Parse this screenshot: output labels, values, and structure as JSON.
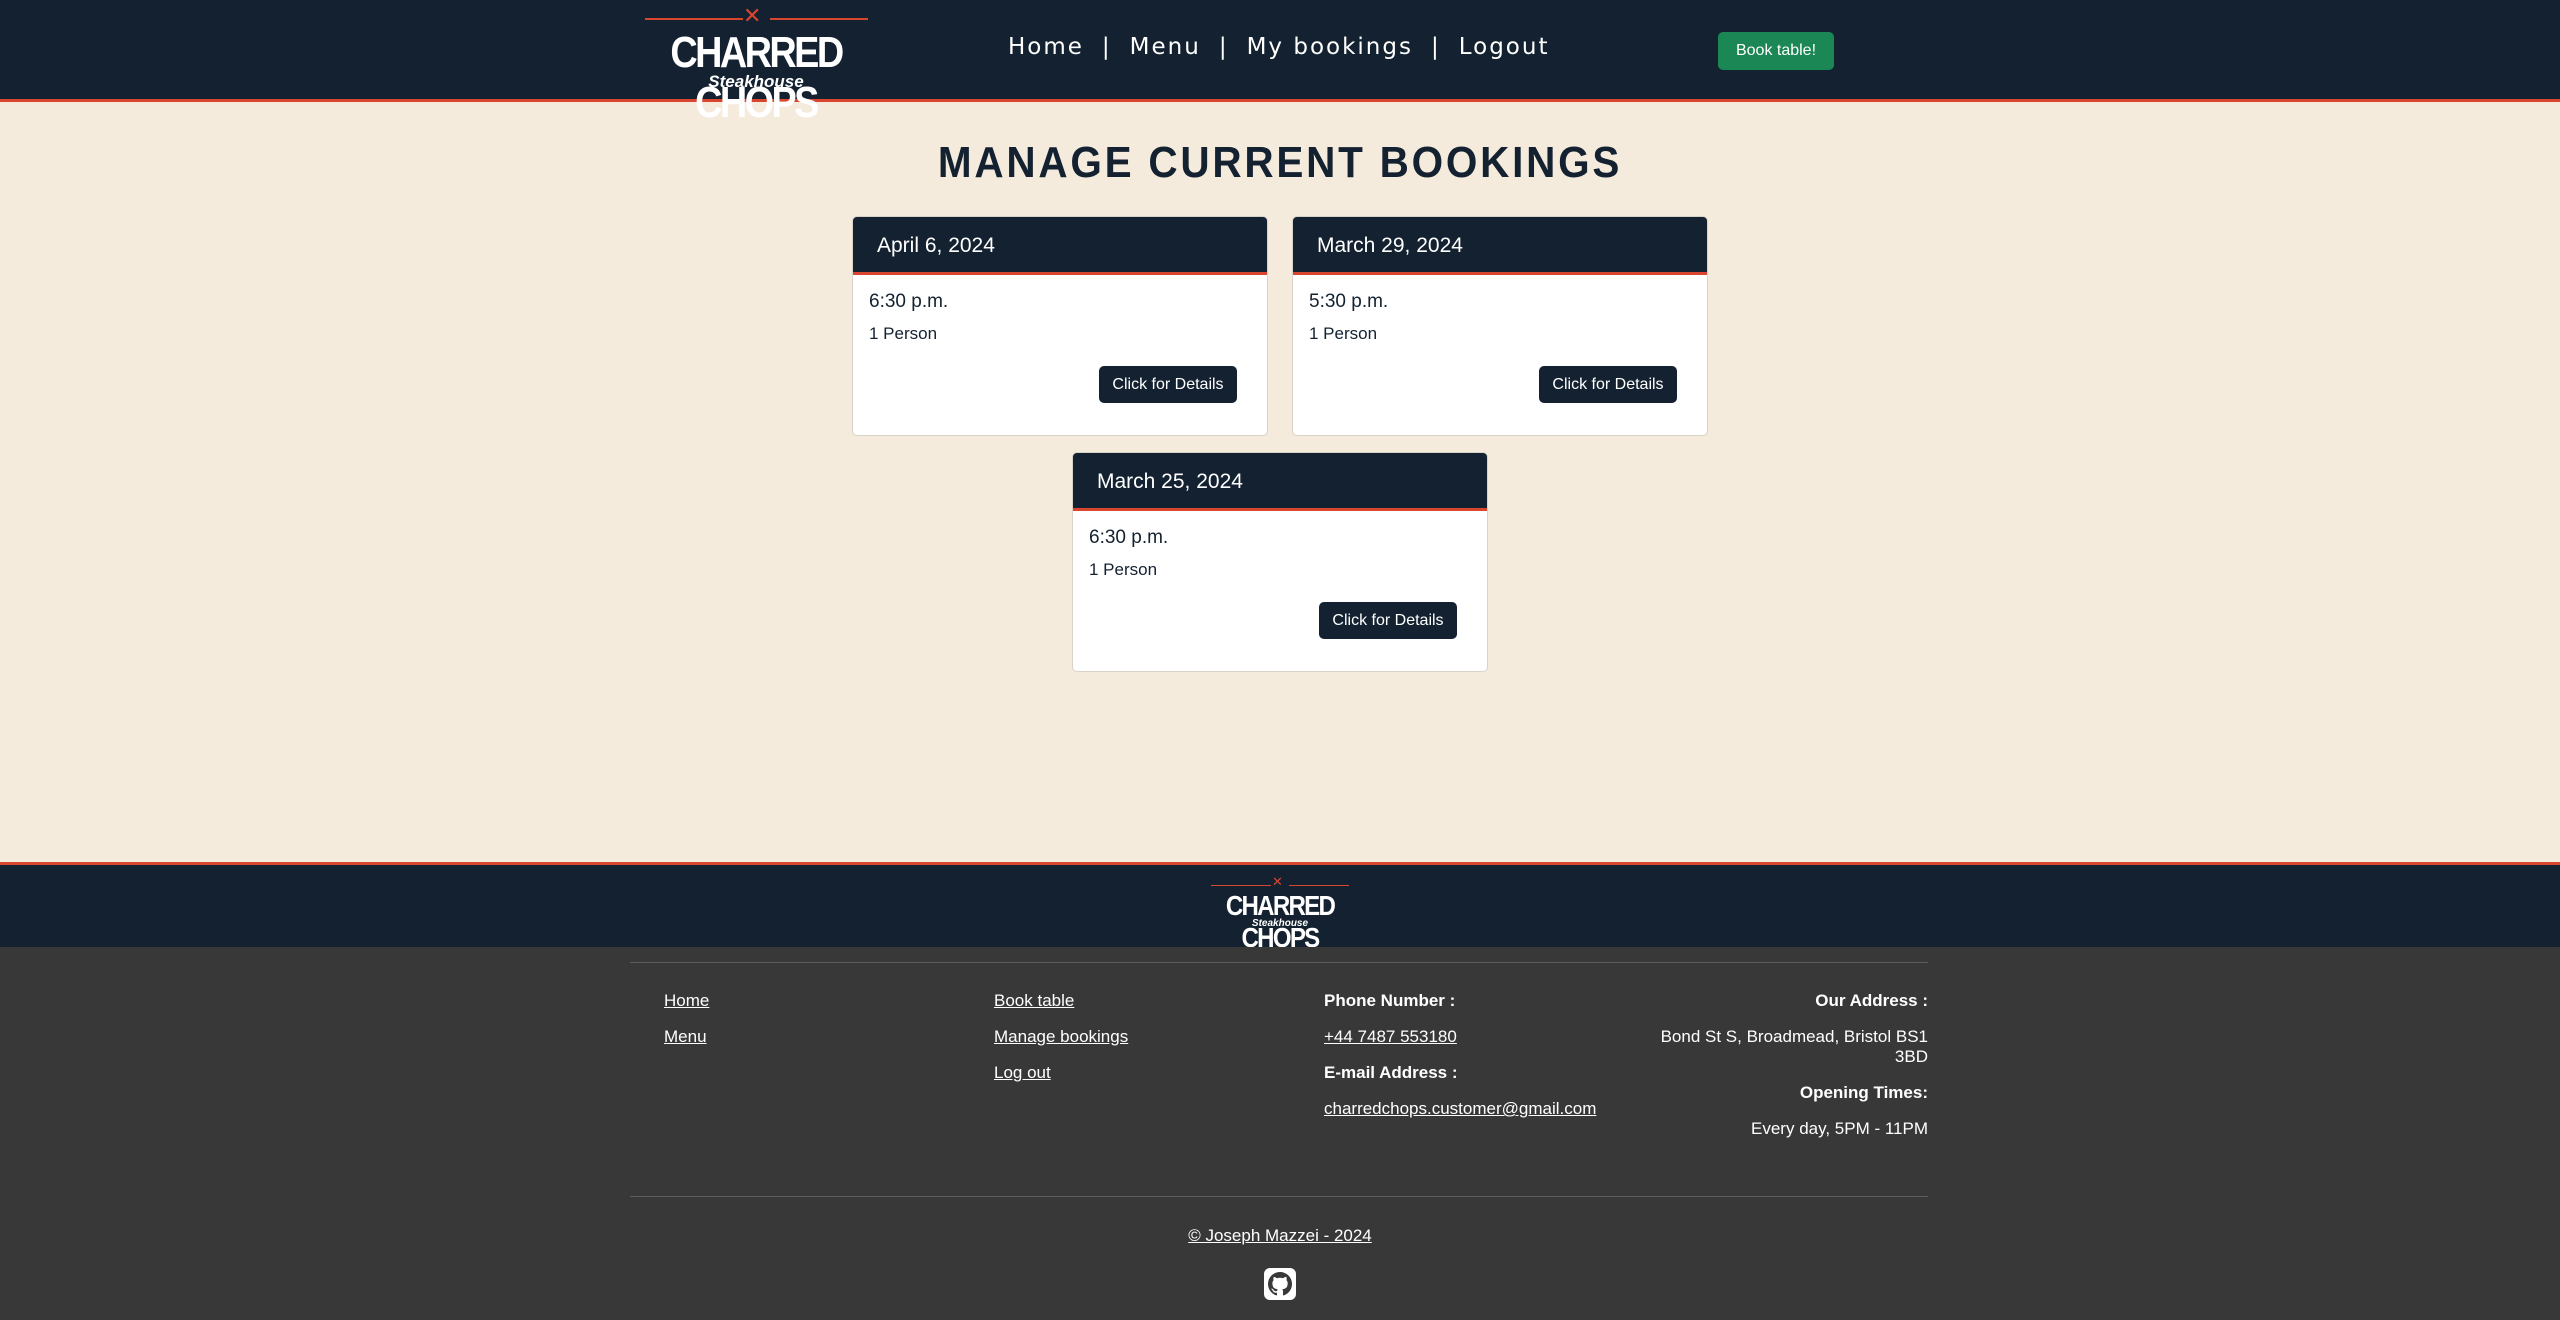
{
  "brand": {
    "name": "CHARRED CHOPS",
    "tagline": "Steakhouse"
  },
  "nav": {
    "links": [
      "Home",
      "Menu",
      "My bookings",
      "Logout"
    ],
    "separator": "|",
    "book_button": "Book table!"
  },
  "page": {
    "title": "MANAGE CURRENT BOOKINGS"
  },
  "bookings": [
    {
      "date": "April 6, 2024",
      "time": "6:30 p.m.",
      "people": "1 Person",
      "button": "Click for Details"
    },
    {
      "date": "March 29, 2024",
      "time": "5:30 p.m.",
      "people": "1 Person",
      "button": "Click for Details"
    },
    {
      "date": "March 25, 2024",
      "time": "6:30 p.m.",
      "people": "1 Person",
      "button": "Click for Details"
    }
  ],
  "footer": {
    "col1": [
      "Home",
      "Menu"
    ],
    "col2": [
      "Book table",
      "Manage bookings",
      "Log out"
    ],
    "phone_label": "Phone Number :",
    "phone": "+44 7487 553180",
    "email_label": "E-mail Address :",
    "email": "charredchops.customer@gmail.com",
    "address_label": "Our Address :",
    "address_line1": "Bond St S, Broadmead, Bristol BS1",
    "address_line2": "3BD",
    "hours_label": "Opening Times:",
    "hours": "Every day, 5PM - 11PM",
    "copyright": "© Joseph Mazzei - 2024",
    "github_icon": "github-icon"
  },
  "colors": {
    "navy": "#132130",
    "accent": "#d9462f",
    "cream": "#f5ebdd",
    "green": "#1a8754",
    "footer_gray": "#383838"
  }
}
